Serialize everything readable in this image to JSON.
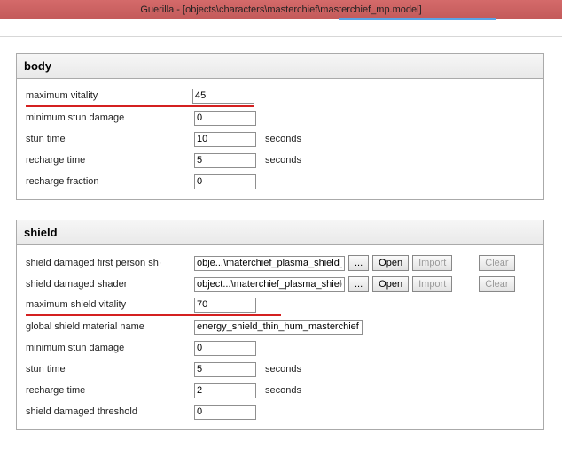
{
  "title": "Guerilla - [objects\\characters\\masterchief\\masterchief_mp.model]",
  "body": {
    "header": "body",
    "max_vitality": {
      "label": "maximum vitality",
      "value": "45"
    },
    "min_stun": {
      "label": "minimum stun damage",
      "value": "0"
    },
    "stun_time": {
      "label": "stun time",
      "value": "10",
      "unit": "seconds"
    },
    "recharge_time": {
      "label": "recharge time",
      "value": "5",
      "unit": "seconds"
    },
    "recharge_fraction": {
      "label": "recharge fraction",
      "value": "0"
    }
  },
  "shield": {
    "header": "shield",
    "dmg_fp": {
      "label": "shield damaged first person sh·",
      "value": "obje...\\materchief_plasma_shield_fp.shader"
    },
    "dmg": {
      "label": "shield damaged shader",
      "value": "object...\\materchief_plasma_shield.shader"
    },
    "max_vitality": {
      "label": "maximum shield vitality",
      "value": "70"
    },
    "global_mat": {
      "label": "global shield material name",
      "value": "energy_shield_thin_hum_masterchief"
    },
    "min_stun": {
      "label": "minimum stun damage",
      "value": "0"
    },
    "stun_time": {
      "label": "stun time",
      "value": "5",
      "unit": "seconds"
    },
    "recharge_time": {
      "label": "recharge time",
      "value": "2",
      "unit": "seconds"
    },
    "dmg_thresh": {
      "label": "shield damaged threshold",
      "value": "0"
    }
  },
  "btn": {
    "browse": "...",
    "open": "Open",
    "import": "Import",
    "clear": "Clear"
  }
}
